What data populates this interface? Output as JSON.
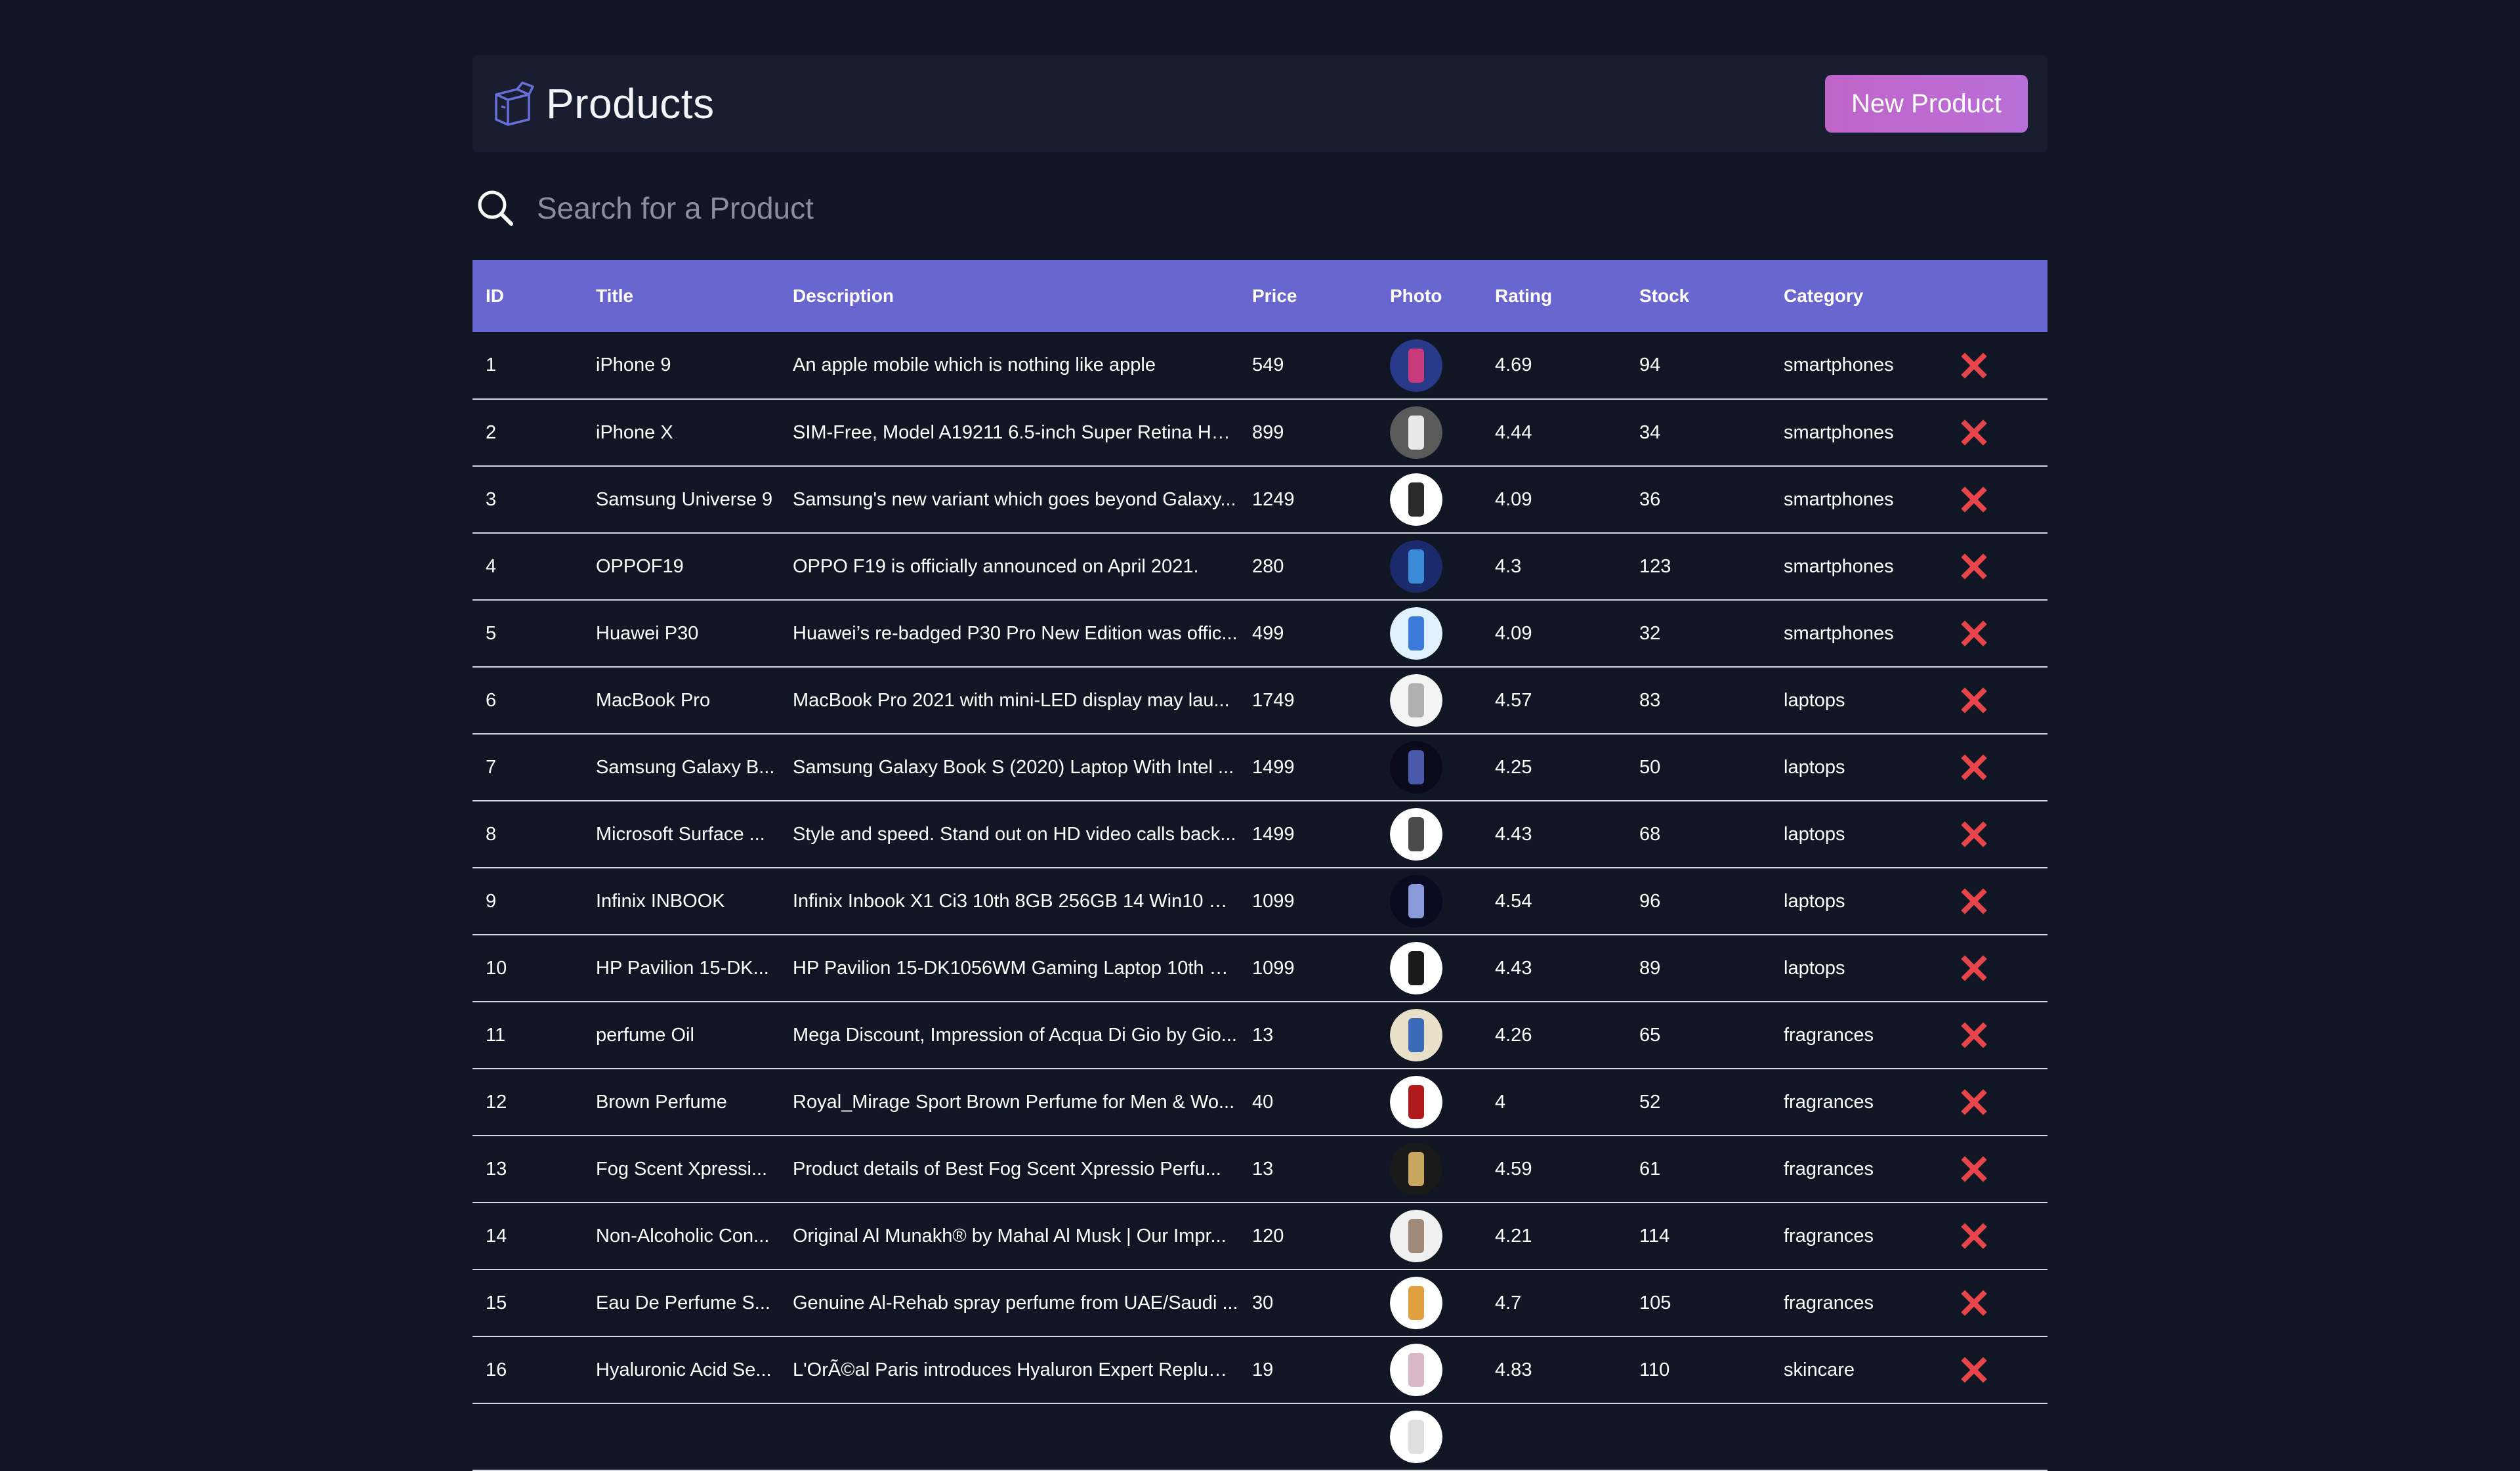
{
  "header": {
    "title": "Products",
    "new_button_label": "New Product"
  },
  "search": {
    "placeholder": "Search for a Product",
    "value": ""
  },
  "table": {
    "columns": [
      "ID",
      "Title",
      "Description",
      "Price",
      "Photo",
      "Rating",
      "Stock",
      "Category"
    ],
    "rows": [
      {
        "id": "1",
        "title": "iPhone 9",
        "description": "An apple mobile which is nothing like apple",
        "price": "549",
        "rating": "4.69",
        "stock": "94",
        "category": "smartphones",
        "photo_colors": [
          "#2a3a8a",
          "#c83a7a"
        ]
      },
      {
        "id": "2",
        "title": "iPhone X",
        "description": "SIM-Free, Model A19211 6.5-inch Super Retina HD...",
        "price": "899",
        "rating": "4.44",
        "stock": "34",
        "category": "smartphones",
        "photo_colors": [
          "#5a5a5a",
          "#e8e8e8"
        ]
      },
      {
        "id": "3",
        "title": "Samsung Universe 9",
        "description": "Samsung's new variant which goes beyond Galaxy...",
        "price": "1249",
        "rating": "4.09",
        "stock": "36",
        "category": "smartphones",
        "photo_colors": [
          "#ffffff",
          "#2a2a2a"
        ]
      },
      {
        "id": "4",
        "title": "OPPOF19",
        "description": "OPPO F19 is officially announced on April 2021.",
        "price": "280",
        "rating": "4.3",
        "stock": "123",
        "category": "smartphones",
        "photo_colors": [
          "#1a2a6a",
          "#3a8ad8"
        ]
      },
      {
        "id": "5",
        "title": "Huawei P30",
        "description": "Huawei’s re-badged P30 Pro New Edition was offic...",
        "price": "499",
        "rating": "4.09",
        "stock": "32",
        "category": "smartphones",
        "photo_colors": [
          "#e0f0ff",
          "#3a7ad8"
        ]
      },
      {
        "id": "6",
        "title": "MacBook Pro",
        "description": "MacBook Pro 2021 with mini-LED display may lau...",
        "price": "1749",
        "rating": "4.57",
        "stock": "83",
        "category": "laptops",
        "photo_colors": [
          "#f4f4f4",
          "#b0b0b0"
        ]
      },
      {
        "id": "7",
        "title": "Samsung Galaxy B...",
        "description": "Samsung Galaxy Book S (2020) Laptop With Intel ...",
        "price": "1499",
        "rating": "4.25",
        "stock": "50",
        "category": "laptops",
        "photo_colors": [
          "#0a0a1a",
          "#4a5aaa"
        ]
      },
      {
        "id": "8",
        "title": "Microsoft Surface ...",
        "description": "Style and speed. Stand out on HD video calls back...",
        "price": "1499",
        "rating": "4.43",
        "stock": "68",
        "category": "laptops",
        "photo_colors": [
          "#ffffff",
          "#4a4a4a"
        ]
      },
      {
        "id": "9",
        "title": "Infinix INBOOK",
        "description": "Infinix Inbook X1 Ci3 10th 8GB 256GB 14 Win10 G...",
        "price": "1099",
        "rating": "4.54",
        "stock": "96",
        "category": "laptops",
        "photo_colors": [
          "#0a0a20",
          "#8a9ad8"
        ]
      },
      {
        "id": "10",
        "title": "HP Pavilion 15-DK...",
        "description": "HP Pavilion 15-DK1056WM Gaming Laptop 10th G...",
        "price": "1099",
        "rating": "4.43",
        "stock": "89",
        "category": "laptops",
        "photo_colors": [
          "#ffffff",
          "#1a1a1a"
        ]
      },
      {
        "id": "11",
        "title": "perfume Oil",
        "description": "Mega Discount, Impression of Acqua Di Gio by Gio...",
        "price": "13",
        "rating": "4.26",
        "stock": "65",
        "category": "fragrances",
        "photo_colors": [
          "#e8e0c8",
          "#3a6ab8"
        ]
      },
      {
        "id": "12",
        "title": "Brown Perfume",
        "description": "Royal_Mirage Sport Brown Perfume for Men & Wo...",
        "price": "40",
        "rating": "4",
        "stock": "52",
        "category": "fragrances",
        "photo_colors": [
          "#ffffff",
          "#b01a1a"
        ]
      },
      {
        "id": "13",
        "title": "Fog Scent Xpressi...",
        "description": "Product details of Best Fog Scent Xpressio Perfu...",
        "price": "13",
        "rating": "4.59",
        "stock": "61",
        "category": "fragrances",
        "photo_colors": [
          "#1a1a1a",
          "#c8a860"
        ]
      },
      {
        "id": "14",
        "title": "Non-Alcoholic Con...",
        "description": "Original Al Munakh® by Mahal Al Musk | Our Impr...",
        "price": "120",
        "rating": "4.21",
        "stock": "114",
        "category": "fragrances",
        "photo_colors": [
          "#f0f0f0",
          "#a08a7a"
        ]
      },
      {
        "id": "15",
        "title": "Eau De Perfume S...",
        "description": "Genuine Al-Rehab spray perfume from UAE/Saudi ...",
        "price": "30",
        "rating": "4.7",
        "stock": "105",
        "category": "fragrances",
        "photo_colors": [
          "#ffffff",
          "#e0a040"
        ]
      },
      {
        "id": "16",
        "title": "Hyaluronic Acid Se...",
        "description": "L'OrÃ©al Paris introduces Hyaluron Expert Replum...",
        "price": "19",
        "rating": "4.83",
        "stock": "110",
        "category": "skincare",
        "photo_colors": [
          "#ffffff",
          "#d8b8c8"
        ]
      },
      {
        "id": "",
        "title": "",
        "description": "",
        "price": "",
        "rating": "",
        "stock": "",
        "category": "",
        "photo_colors": [
          "#ffffff",
          "#e0e0e0"
        ]
      }
    ]
  },
  "colors": {
    "background": "#111625",
    "header_bg": "#181e30",
    "table_header": "#6a66cf",
    "accent_button": "#c064c8",
    "delete_icon": "#e8454a",
    "row_divider": "#d6d8e0"
  },
  "icons": {
    "logo": "box-icon",
    "search": "search-icon",
    "delete": "close-icon"
  }
}
